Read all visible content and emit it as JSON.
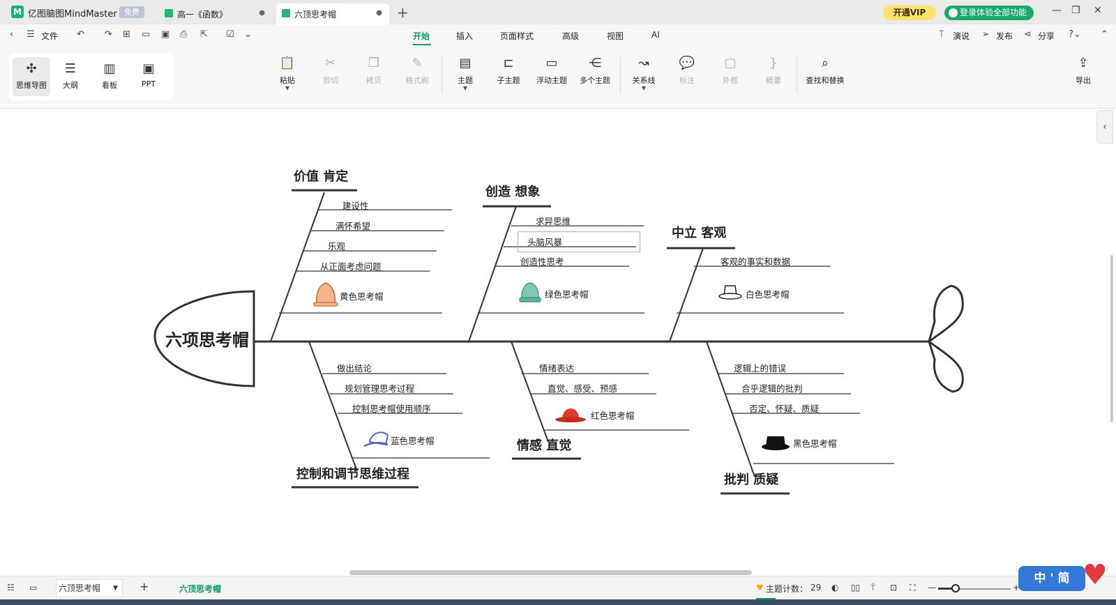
{
  "app": {
    "name": "亿图脑图MindMaster",
    "free_badge": "免费",
    "logo_letter": "M"
  },
  "tabs": [
    {
      "label": "高一《函数》",
      "dot": "●"
    },
    {
      "label": "六顶思考帽",
      "dot": "●"
    }
  ],
  "new_tab": "+",
  "header": {
    "vip": "开通VIP",
    "login": "登录体验全部功能"
  },
  "window_controls": {
    "minimize": "—",
    "restore": "❐",
    "close": "✕"
  },
  "menu": {
    "file": "文件",
    "items": [
      "开始",
      "插入",
      "页面样式",
      "高级",
      "视图",
      "AI"
    ],
    "right": {
      "present": "演说",
      "publish": "发布",
      "share": "分享"
    }
  },
  "views": [
    {
      "label": "思维导图",
      "icon": "mindmap-icon",
      "glyph": "✣"
    },
    {
      "label": "大纲",
      "icon": "outline-icon",
      "glyph": "☰"
    },
    {
      "label": "看板",
      "icon": "kanban-icon",
      "glyph": "▥"
    },
    {
      "label": "PPT",
      "icon": "ppt-icon",
      "glyph": "▣"
    }
  ],
  "toolbar": [
    {
      "label": "粘贴",
      "glyph": "📋"
    },
    {
      "label": "剪切",
      "glyph": "✂"
    },
    {
      "label": "拷贝",
      "glyph": "❐"
    },
    {
      "label": "格式刷",
      "glyph": "✎"
    },
    {
      "label": "主题",
      "glyph": "▤"
    },
    {
      "label": "子主题",
      "glyph": "⊏"
    },
    {
      "label": "浮动主题",
      "glyph": "▭"
    },
    {
      "label": "多个主题",
      "glyph": "⋲"
    },
    {
      "label": "关系线",
      "glyph": "↝"
    },
    {
      "label": "标注",
      "glyph": "💬"
    },
    {
      "label": "外框",
      "glyph": "▢"
    },
    {
      "label": "概要",
      "glyph": "}"
    },
    {
      "label": "查找和替换",
      "glyph": "⌕"
    },
    {
      "label": "导出",
      "glyph": "⇪"
    }
  ],
  "diagram": {
    "head": "六项思考帽",
    "branches": {
      "yellow": {
        "title": "价值 肯定",
        "items": [
          "建设性",
          "满怀希望",
          "乐观",
          "从正面考虑问题"
        ],
        "hat": "黄色思考帽"
      },
      "green": {
        "title": "创造 想象",
        "items": [
          "求异思维",
          "头脑风暴",
          "创造性思考"
        ],
        "hat": "绿色思考帽"
      },
      "white": {
        "title": "中立 客观",
        "items": [
          "客观的事实和数据"
        ],
        "hat": "白色思考帽"
      },
      "blue": {
        "title": "控制和调节思维过程",
        "items": [
          "做出结论",
          "规划管理思考过程",
          "控制思考帽使用顺序"
        ],
        "hat": "蓝色思考帽"
      },
      "red": {
        "title": "情感 直觉",
        "items": [
          "情绪表达",
          "直觉、感受、预感"
        ],
        "hat": "红色思考帽"
      },
      "black": {
        "title": "批判 质疑",
        "items": [
          "逻辑上的错误",
          "合乎逻辑的批判",
          "否定、怀疑、质疑"
        ],
        "hat": "黑色思考帽"
      }
    },
    "colors": {
      "yellow_hat": "#f6b48a",
      "green_hat": "#7fc8b4",
      "red_hat": "#e03a2e",
      "blue_hat": "#5a62c8",
      "black_hat": "#111111"
    }
  },
  "status": {
    "sheet_name": "六顶思考帽",
    "active_sheet": "六顶思考帽",
    "topic_count_label": "主题计数：",
    "topic_count": "29",
    "zoom_minus": "—",
    "zoom_plus": "+"
  },
  "ime": {
    "label": "中 ' 简"
  },
  "accent": "#0c9b63"
}
